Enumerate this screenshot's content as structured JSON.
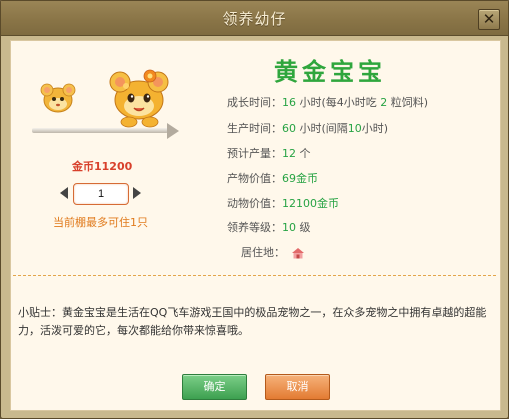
{
  "window": {
    "title": "领养幼仔",
    "close_glyph": "✕"
  },
  "pet": {
    "name": "黄金宝宝",
    "price": "金币11200",
    "quantity": "1",
    "limit_text": "当前棚最多可住1只"
  },
  "info": {
    "growth": {
      "label": "成长时间：",
      "value": "16",
      "unit": " 小时(每4小时吃 ",
      "feed": "2",
      "feed_unit": " 粒饲料)"
    },
    "production": {
      "label": "生产时间：",
      "value": "60",
      "unit": " 小时(间隔",
      "interval": "10",
      "interval_unit": "小时)"
    },
    "yield": {
      "label": "预计产量：",
      "value": "12",
      "unit": " 个"
    },
    "product_value": {
      "label": "产物价值：",
      "value": "69金币"
    },
    "animal_value": {
      "label": "动物价值：",
      "value": "12100金币"
    },
    "level": {
      "label": "领养等级：",
      "value": "10",
      "unit": " 级"
    },
    "habitat": {
      "label": "居住地：",
      "icon": "barn-icon"
    }
  },
  "tip": "小贴士：黄金宝宝是生活在QQ飞车游戏王国中的极品宠物之一，在众多宠物之中拥有卓越的超能力，活泼可爱的它，每次都能给你带来惊喜哦。",
  "buttons": {
    "ok": "确定",
    "cancel": "取消"
  },
  "colors": {
    "green": "#27a344",
    "orange": "#e07a1c",
    "red": "#d8402b"
  }
}
